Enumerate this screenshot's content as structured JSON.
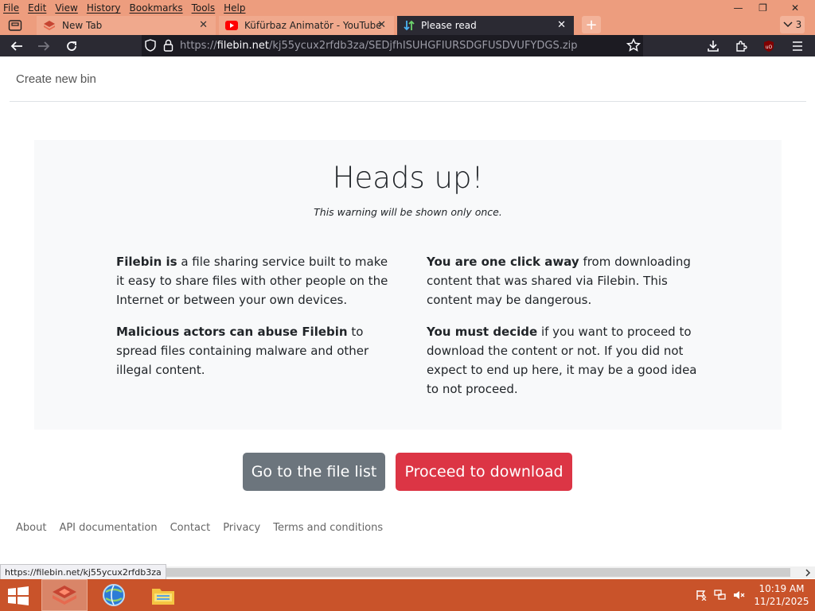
{
  "browser": {
    "menu": [
      "File",
      "Edit",
      "View",
      "History",
      "Bookmarks",
      "Tools",
      "Help"
    ],
    "window_controls": {
      "minimize": "—",
      "restore": "❐",
      "close": "✕"
    },
    "tabs": [
      {
        "title": "New Tab",
        "active": false,
        "icon": "filebin-icon",
        "close": "✕"
      },
      {
        "title": "Küfürbaz Animatör - YouTube",
        "active": false,
        "icon": "youtube-icon",
        "close": "✕"
      },
      {
        "title": "Please read",
        "active": true,
        "icon": "transfer-icon",
        "close": "✕"
      }
    ],
    "new_tab_label": "+",
    "tab_count": "3",
    "url_scheme": "https://",
    "url_host": "filebin.net",
    "url_path": "/kj55ycux2rfdb3za/SEDjfhISUHGFIURSDGFUSDVUFYDGS.zip",
    "colors": {
      "titlebar": "#ed9d7e",
      "toolbar": "#2b2a33"
    }
  },
  "page": {
    "header_link": "Create new bin",
    "heading": "Heads up!",
    "subheading": "This warning will be shown only once.",
    "left_column": [
      {
        "bold": "Filebin is",
        "text": " a file sharing service built to make it easy to share files with other people on the Internet or between your own devices."
      },
      {
        "bold": "Malicious actors can abuse Filebin",
        "text": " to spread files containing malware and other illegal content."
      }
    ],
    "right_column": [
      {
        "bold": "You are one click away",
        "text": " from downloading content that was shared via Filebin. This content may be dangerous."
      },
      {
        "bold": "You must decide",
        "text": " if you want to proceed to download the content or not. If you did not expect to end up here, it may be a good idea to not proceed."
      }
    ],
    "btn_file_list": "Go to the file list",
    "btn_proceed": "Proceed to download",
    "footer_links": [
      "About",
      "API documentation",
      "Contact",
      "Privacy",
      "Terms and conditions"
    ],
    "colors": {
      "secondary": "#6c757d",
      "danger": "#dc3545",
      "box_bg": "#f8f9fa"
    }
  },
  "status_tooltip": "https://filebin.net/kj55ycux2rfdb3za",
  "taskbar": {
    "apps": [
      "filebin-firefox-icon",
      "globe-browser-icon",
      "file-explorer-icon"
    ],
    "time": "10:19 AM",
    "date": "11/21/2025",
    "color": "#c9532a"
  }
}
